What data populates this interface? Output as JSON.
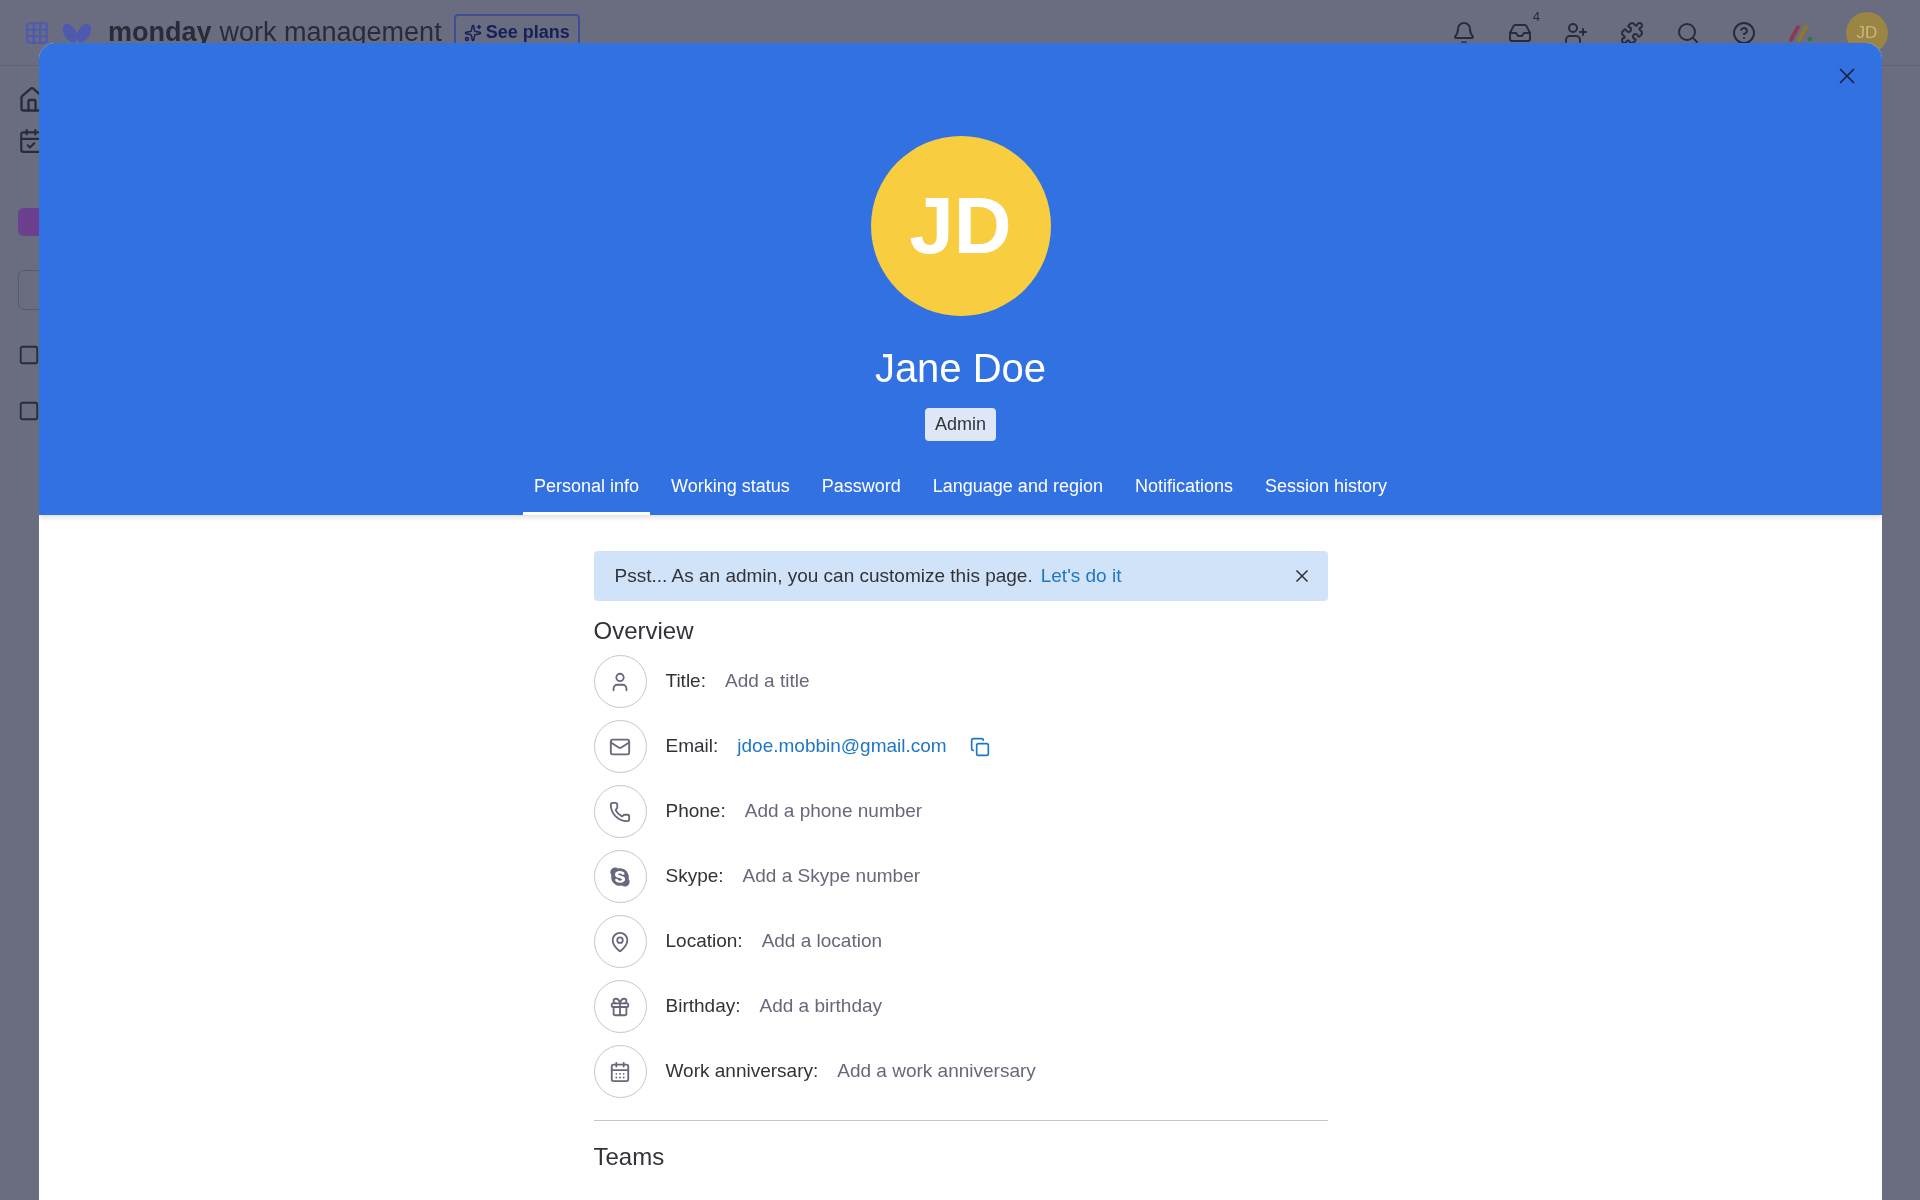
{
  "top_bar": {
    "brand_bold": "monday",
    "brand_rest": "work management",
    "see_plans": "See plans",
    "inbox_count": "4",
    "avatar_initials": "JD"
  },
  "profile": {
    "initials": "JD",
    "name": "Jane Doe",
    "role": "Admin"
  },
  "tabs": [
    {
      "label": "Personal info",
      "selected": true
    },
    {
      "label": "Working status",
      "selected": false
    },
    {
      "label": "Password",
      "selected": false
    },
    {
      "label": "Language and region",
      "selected": false
    },
    {
      "label": "Notifications",
      "selected": false
    },
    {
      "label": "Session history",
      "selected": false
    }
  ],
  "banner": {
    "text": "Psst... As an admin, you can customize this page.",
    "link": "Let's do it"
  },
  "overview": {
    "heading": "Overview",
    "fields": [
      {
        "kind": "title",
        "label": "Title:",
        "value": "Add a title",
        "filled": false
      },
      {
        "kind": "email",
        "label": "Email:",
        "value": "jdoe.mobbin@gmail.com",
        "filled": true
      },
      {
        "kind": "phone",
        "label": "Phone:",
        "value": "Add a phone number",
        "filled": false
      },
      {
        "kind": "skype",
        "label": "Skype:",
        "value": "Add a Skype number",
        "filled": false
      },
      {
        "kind": "location",
        "label": "Location:",
        "value": "Add a location",
        "filled": false
      },
      {
        "kind": "birthday",
        "label": "Birthday:",
        "value": "Add a birthday",
        "filled": false
      },
      {
        "kind": "anniversary",
        "label": "Work anniversary:",
        "value": "Add a work anniversary",
        "filled": false
      }
    ]
  },
  "teams": {
    "heading": "Teams"
  }
}
